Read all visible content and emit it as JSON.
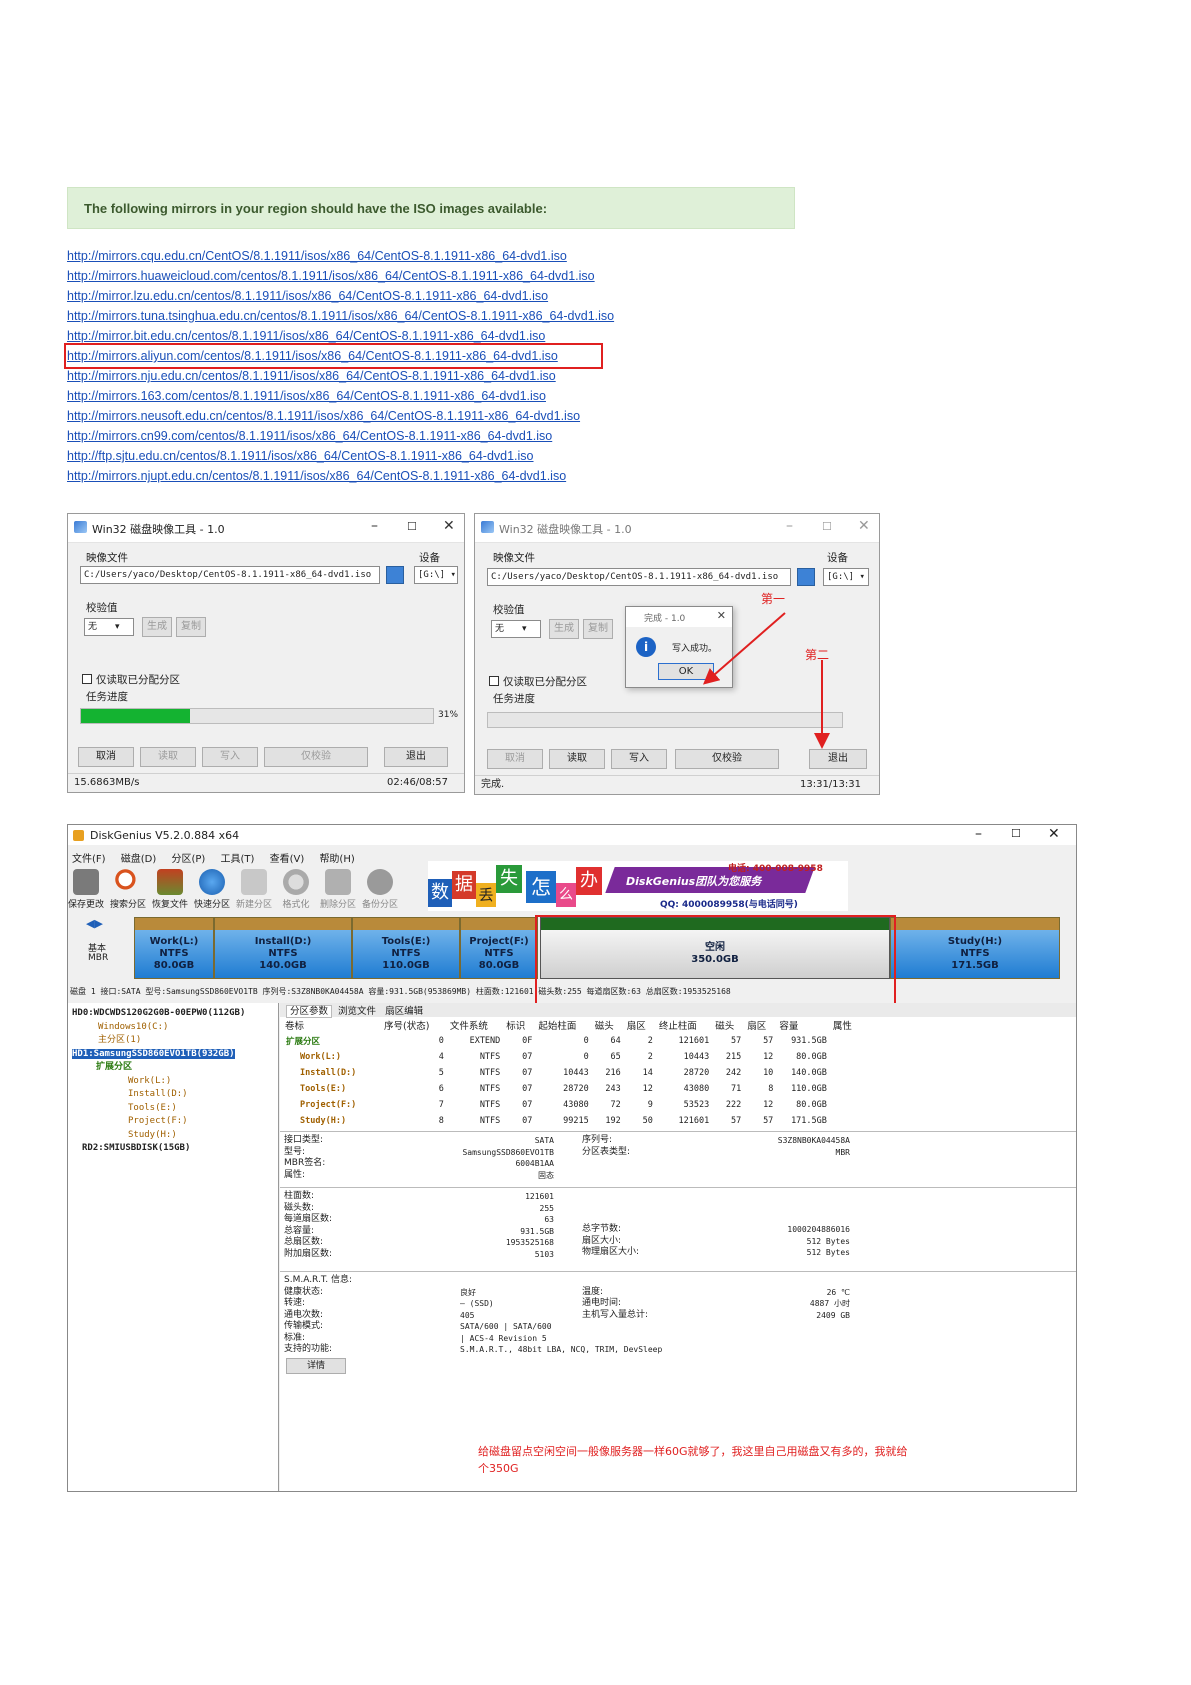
{
  "mirrors": {
    "banner": "The following mirrors in your region should have the ISO images available:",
    "links": [
      "http://mirrors.cqu.edu.cn/CentOS/8.1.1911/isos/x86_64/CentOS-8.1.1911-x86_64-dvd1.iso",
      "http://mirrors.huaweicloud.com/centos/8.1.1911/isos/x86_64/CentOS-8.1.1911-x86_64-dvd1.iso",
      "http://mirror.lzu.edu.cn/centos/8.1.1911/isos/x86_64/CentOS-8.1.1911-x86_64-dvd1.iso",
      "http://mirrors.tuna.tsinghua.edu.cn/centos/8.1.1911/isos/x86_64/CentOS-8.1.1911-x86_64-dvd1.iso",
      "http://mirror.bit.edu.cn/centos/8.1.1911/isos/x86_64/CentOS-8.1.1911-x86_64-dvd1.iso",
      "http://mirrors.aliyun.com/centos/8.1.1911/isos/x86_64/CentOS-8.1.1911-x86_64-dvd1.iso",
      "http://mirrors.nju.edu.cn/centos/8.1.1911/isos/x86_64/CentOS-8.1.1911-x86_64-dvd1.iso",
      "http://mirrors.163.com/centos/8.1.1911/isos/x86_64/CentOS-8.1.1911-x86_64-dvd1.iso",
      "http://mirrors.neusoft.edu.cn/centos/8.1.1911/isos/x86_64/CentOS-8.1.1911-x86_64-dvd1.iso",
      "http://mirrors.cn99.com/centos/8.1.1911/isos/x86_64/CentOS-8.1.1911-x86_64-dvd1.iso",
      "http://ftp.sjtu.edu.cn/centos/8.1.1911/isos/x86_64/CentOS-8.1.1911-x86_64-dvd1.iso",
      "http://mirrors.njupt.edu.cn/centos/8.1.1911/isos/x86_64/CentOS-8.1.1911-x86_64-dvd1.iso"
    ]
  },
  "imager1": {
    "title": "Win32 磁盘映像工具 - 1.0",
    "image_label": "映像文件",
    "device_label": "设备",
    "path": "C:/Users/yaco/Desktop/CentOS-8.1.1911-x86_64-dvd1.iso",
    "device": "[G:\\]",
    "hash_label": "校验值",
    "hash_value": "无",
    "generate": "生成",
    "copy": "复制",
    "readonly": "仅读取已分配分区",
    "progress_label": "任务进度",
    "progress": 0.31,
    "progress_text": "31%",
    "cancel": "取消",
    "read": "读取",
    "write": "写入",
    "verify": "仅校验",
    "exit": "退出",
    "speed": "15.6863MB/s",
    "time": "02:46/08:57"
  },
  "imager2": {
    "title": "Win32 磁盘映像工具 - 1.0",
    "image_label": "映像文件",
    "device_label": "设备",
    "path": "C:/Users/yaco/Desktop/CentOS-8.1.1911-x86_64-dvd1.iso",
    "device": "[G:\\]",
    "hash_label": "校验值",
    "hash_value": "无",
    "generate": "生成",
    "copy": "复制",
    "readonly": "仅读取已分配分区",
    "progress_label": "任务进度",
    "cancel": "取消",
    "read": "读取",
    "write": "写入",
    "verify": "仅校验",
    "exit": "退出",
    "status": "完成.",
    "time": "13:31/13:31",
    "popup_title": "完成 - 1.0",
    "popup_msg": "写入成功。",
    "popup_ok": "OK",
    "note_first": "第一",
    "note_second": "第二"
  },
  "dg": {
    "title": "DiskGenius V5.2.0.884 x64",
    "menu": [
      "文件(F)",
      "磁盘(D)",
      "分区(P)",
      "工具(T)",
      "查看(V)",
      "帮助(H)"
    ],
    "tools": [
      "保存更改",
      "搜索分区",
      "恢复文件",
      "快速分区",
      "新建分区",
      "格式化",
      "删除分区",
      "备份分区"
    ],
    "banner_chars": [
      "数",
      "据",
      "丢",
      "失",
      "怎",
      "么",
      "办"
    ],
    "banner_slogan": "DiskGenius团队为您服务",
    "banner_phone": "电话: 400-008-9958",
    "banner_qq": "QQ: 4000089958(与电话同号)",
    "basic": "基本",
    "mbr": "MBR",
    "partitions": [
      {
        "name": "Work(L:)",
        "fs": "NTFS",
        "size": "80.0GB"
      },
      {
        "name": "Install(D:)",
        "fs": "NTFS",
        "size": "140.0GB"
      },
      {
        "name": "Tools(E:)",
        "fs": "NTFS",
        "size": "110.0GB"
      },
      {
        "name": "Project(F:)",
        "fs": "NTFS",
        "size": "80.0GB"
      },
      {
        "name": "空闲",
        "fs": "",
        "size": "350.0GB"
      },
      {
        "name": "Study(H:)",
        "fs": "NTFS",
        "size": "171.5GB"
      }
    ],
    "disk_line": "磁盘 1 接口:SATA 型号:SamsungSSD860EVO1TB 序列号:S3Z8NB0KA04458A 容量:931.5GB(953869MB) 柱面数:121601 磁头数:255 每道扇区数:63 总扇区数:1953525168",
    "tree": [
      "HD0:WDCWDS120G2G0B-00EPW0(112GB)",
      "Windows10(C:)",
      "主分区(1)",
      "HD1:SamsungSSD860EVO1TB(932GB)",
      "扩展分区",
      "Work(L:)",
      "Install(D:)",
      "Tools(E:)",
      "Project(F:)",
      "Study(H:)",
      "RD2:SMIUSBDISK(15GB)"
    ],
    "tabs": [
      "分区参数",
      "浏览文件",
      "扇区编辑"
    ],
    "columns": [
      "卷标",
      "序号(状态)",
      "文件系统",
      "标识",
      "起始柱面",
      "磁头",
      "扇区",
      "终止柱面",
      "磁头",
      "扇区",
      "容量",
      "属性"
    ],
    "rows": [
      [
        "扩展分区",
        "0",
        "EXTEND",
        "0F",
        "0",
        "64",
        "2",
        "121601",
        "57",
        "57",
        "931.5GB",
        ""
      ],
      [
        "Work(L:)",
        "4",
        "NTFS",
        "07",
        "0",
        "65",
        "2",
        "10443",
        "215",
        "12",
        "80.0GB",
        ""
      ],
      [
        "Install(D:)",
        "5",
        "NTFS",
        "07",
        "10443",
        "216",
        "14",
        "28720",
        "242",
        "10",
        "140.0GB",
        ""
      ],
      [
        "Tools(E:)",
        "6",
        "NTFS",
        "07",
        "28720",
        "243",
        "12",
        "43080",
        "71",
        "8",
        "110.0GB",
        ""
      ],
      [
        "Project(F:)",
        "7",
        "NTFS",
        "07",
        "43080",
        "72",
        "9",
        "53523",
        "222",
        "12",
        "80.0GB",
        ""
      ],
      [
        "Study(H:)",
        "8",
        "NTFS",
        "07",
        "99215",
        "192",
        "50",
        "121601",
        "57",
        "57",
        "171.5GB",
        ""
      ]
    ],
    "info1_labels": "接口类型:\n型号:\nMBR签名:\n属性:",
    "info1_values": "SATA\nSamsungSSD860EVO1TB\n6004B1AA\n固态",
    "info1b_labels": "序列号:\n分区表类型:",
    "info1b_values": "S3Z8NB0KA04458A\nMBR",
    "info2_labels": "柱面数:\n磁头数:\n每道扇区数:\n总容量:\n总扇区数:\n附加扇区数:",
    "info2_values": "121601\n255\n63\n931.5GB\n1953525168\n5103",
    "info2b_labels": "总字节数:\n扇区大小:\n物理扇区大小:",
    "info2b_values": "1000204886016\n512 Bytes\n512 Bytes",
    "info3_labels": "S.M.A.R.T. 信息:\n健康状态:\n转速:\n通电次数:\n传输模式:\n标准:\n支持的功能:",
    "info3_values": "\n良好\n— (SSD)\n405\nSATA/600 | SATA/600\n| ACS-4 Revision 5\nS.M.A.R.T., 48bit LBA, NCQ, TRIM, DevSleep",
    "info3b_labels": "\n温度:\n通电时间:\n主机写入量总计:",
    "info3b_values": "\n26 ℃\n4887 小时\n2409 GB",
    "details": "详情",
    "note": "给磁盘留点空闲空间一般像服务器一样60G就够了，我这里自己用磁盘又有多的，我就给个350G"
  },
  "colors": {
    "accent_red": "#e02020",
    "progress_green": "#14b331",
    "link_blue": "#1a4fb8",
    "banner_green": "#dff0d8"
  }
}
